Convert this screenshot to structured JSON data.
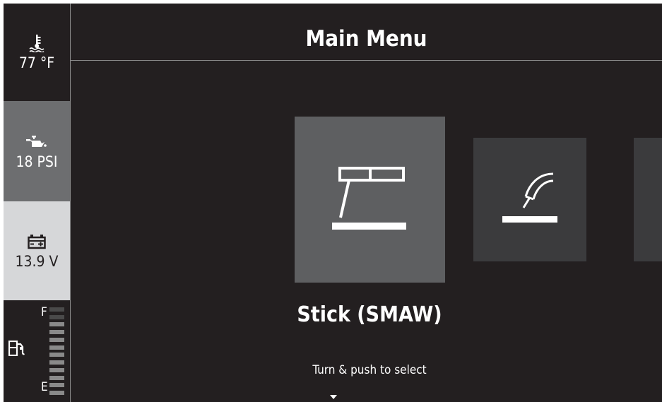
{
  "sidebar": {
    "temperature": {
      "value": "77 °F",
      "icon": "coolant-temperature-icon"
    },
    "oil_pressure": {
      "value": "18 PSI",
      "icon": "oil-can-icon"
    },
    "battery": {
      "value": "13.9 V",
      "icon": "battery-icon"
    },
    "fuel": {
      "full_label": "F",
      "empty_label": "E",
      "icon": "fuel-pump-icon",
      "level_fraction": 0.83,
      "segments_total": 12,
      "segments_lit": 10
    }
  },
  "header": {
    "title": "Main Menu"
  },
  "carousel": {
    "selected_label": "Stick (SMAW)",
    "items": [
      {
        "icon": "stick-welding-icon",
        "selected": true
      },
      {
        "icon": "mig-torch-icon",
        "selected": false
      },
      {
        "icon": "next-mode-icon",
        "selected": false
      }
    ]
  },
  "footer": {
    "hint": "Turn & push to select",
    "icon": "down-arrow-icon"
  },
  "colors": {
    "background": "#231f20",
    "highlight_tile": "#5e5f61",
    "tile": "#3b3b3d",
    "oil_panel": "#6d6e70",
    "battery_panel": "#d6d7d9",
    "text": "#ffffff"
  }
}
